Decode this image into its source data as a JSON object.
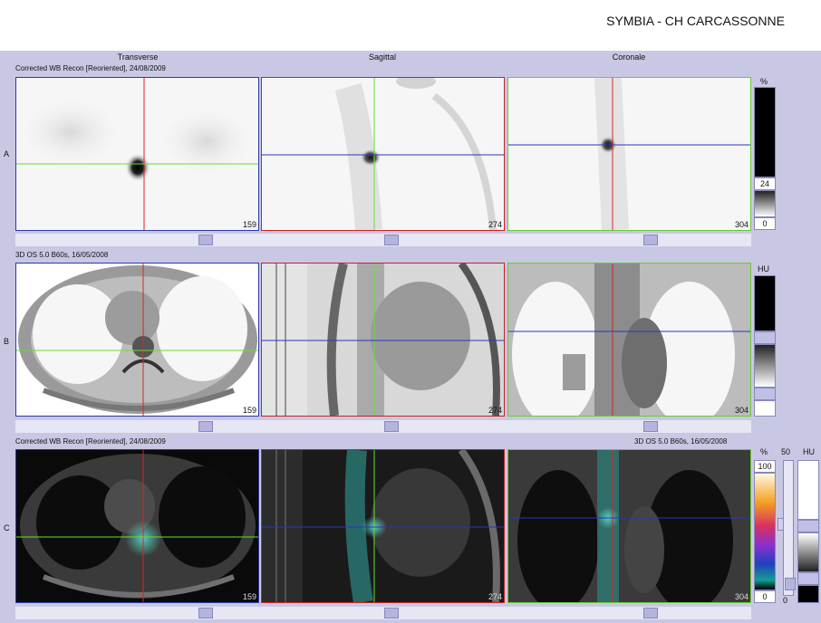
{
  "header": {
    "site": "SYMBIA - CH CARCASSONNE"
  },
  "columns": [
    "Transverse",
    "Sagittal",
    "Coronale"
  ],
  "rows": {
    "a": {
      "letter": "A",
      "title": "Corrected WB Recon [Reoriented], 24/08/2009",
      "slices": [
        "159",
        "274",
        "304"
      ],
      "scale": {
        "unit": "%",
        "mid": "24",
        "min": "0"
      }
    },
    "b": {
      "letter": "B",
      "title": "3D  OS  5.0  B60s, 16/05/2008",
      "slices": [
        "159",
        "274",
        "304"
      ],
      "scale": {
        "unit": "HU"
      }
    },
    "c": {
      "letter": "C",
      "title_left": "Corrected WB Recon [Reoriented], 24/08/2009",
      "title_right": "3D  OS  5.0  B60s, 16/05/2008",
      "slices": [
        "159",
        "274",
        "304"
      ],
      "scale": {
        "unit1": "%",
        "unit2": "50",
        "unit3": "HU",
        "max": "100",
        "min": "0",
        "bottom": "0"
      }
    }
  },
  "colors": {
    "frame_transverse": "#2a3aa8",
    "frame_sagittal": "#cc2222",
    "frame_coronal": "#66cc33",
    "line_red": "#dd2222",
    "line_green": "#66dd33",
    "line_blue": "#2a34c0",
    "background": "#c8c8e4"
  }
}
